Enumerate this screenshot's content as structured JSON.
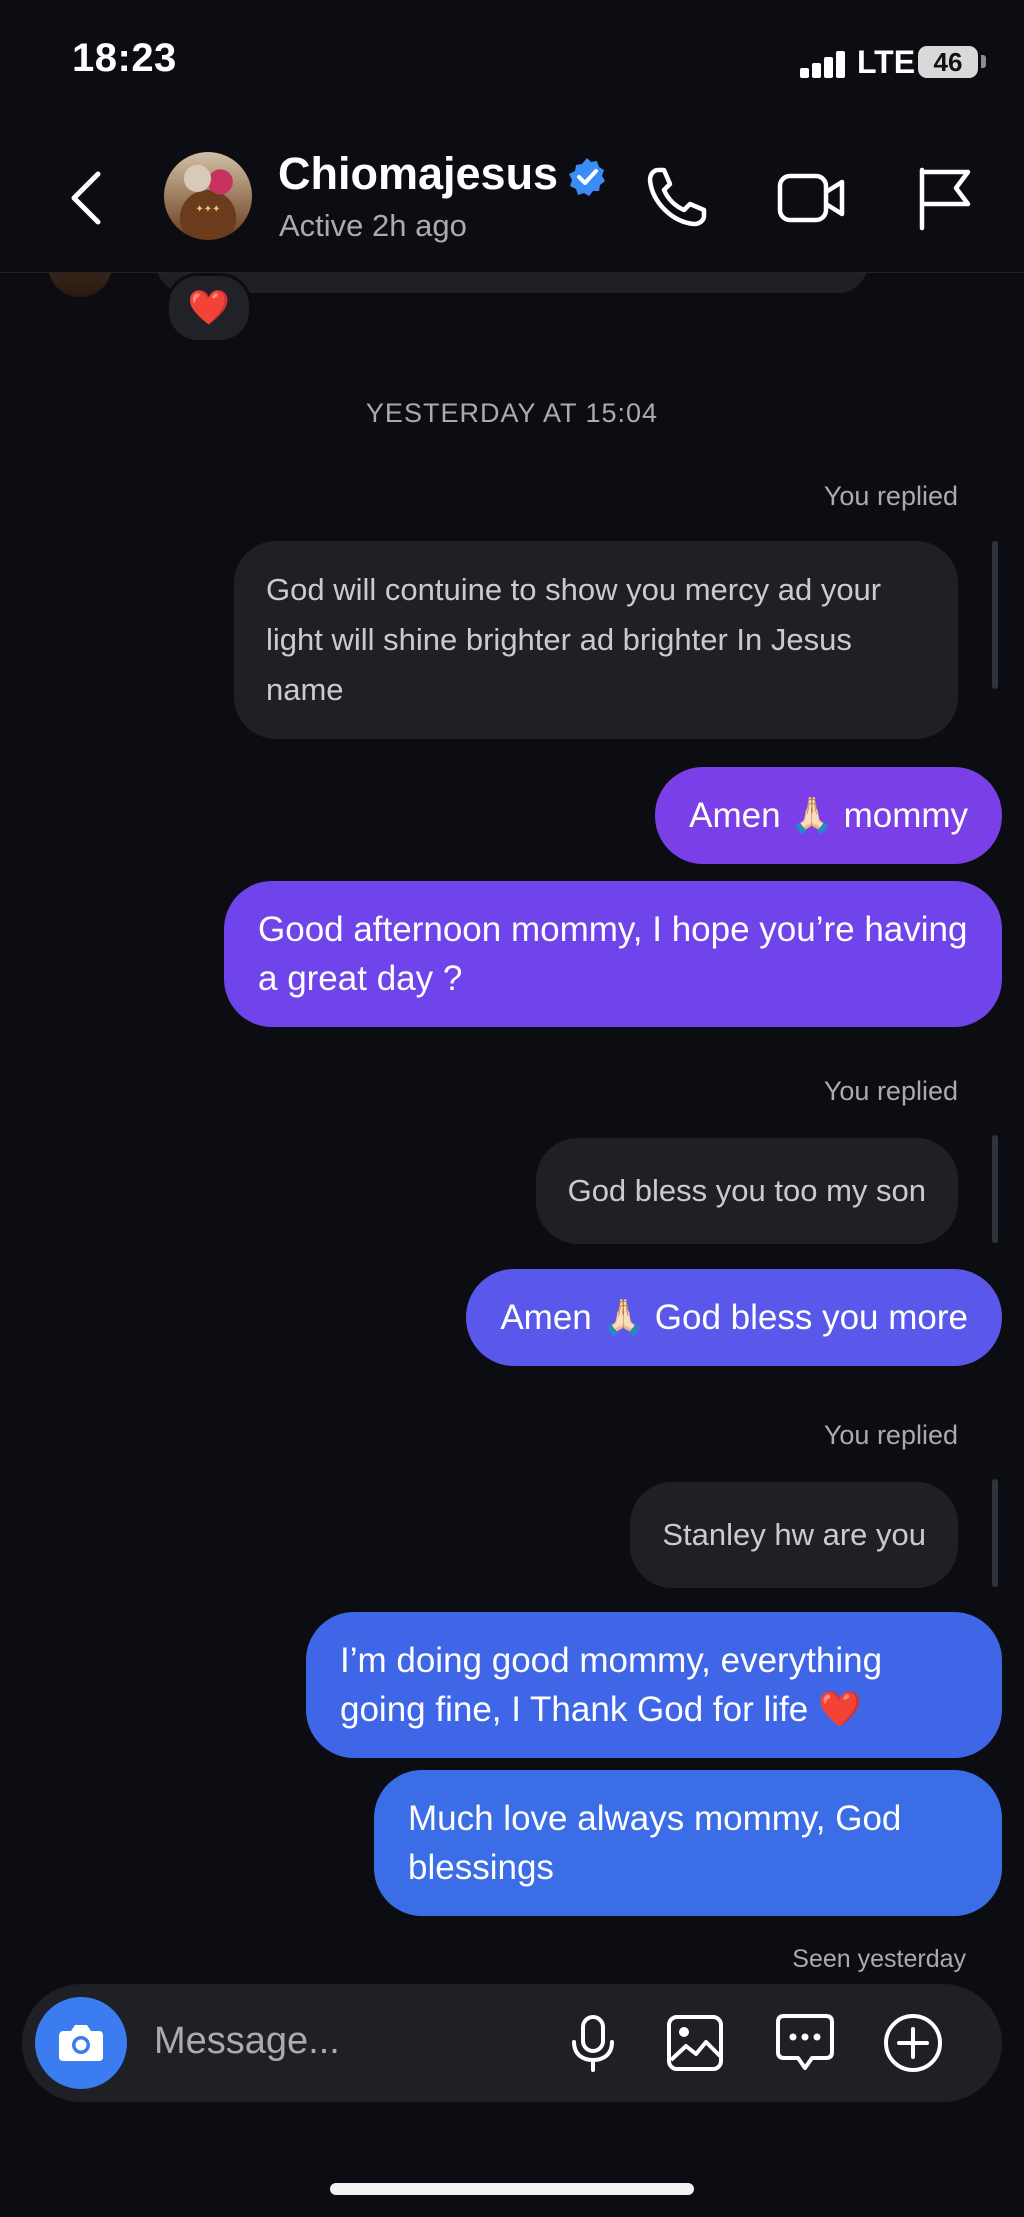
{
  "status_bar": {
    "time": "18:23",
    "network": "LTE",
    "battery": "46"
  },
  "header": {
    "contact_name": "Chiomajesus",
    "active_status": "Active 2h ago",
    "verified": true,
    "icons": [
      "back-icon",
      "phone-icon",
      "video-camera-icon",
      "flag-icon"
    ]
  },
  "chat": {
    "previous_reaction": "❤️",
    "timestamp": "YESTERDAY AT 15:04",
    "messages": [
      {
        "type": "reply-label",
        "text": "You replied"
      },
      {
        "type": "replied",
        "text": "God will contuine to show you mercy ad your light will shine brighter ad brighter In Jesus name"
      },
      {
        "type": "sent",
        "text": "Amen 🙏🏻 mommy"
      },
      {
        "type": "sent",
        "text": "Good afternoon mommy, I hope you’re having a great day ?"
      },
      {
        "type": "reply-label",
        "text": "You replied"
      },
      {
        "type": "replied",
        "text": "God bless you too my  son"
      },
      {
        "type": "sent",
        "text": "Amen 🙏🏻 God bless you more"
      },
      {
        "type": "reply-label",
        "text": "You replied"
      },
      {
        "type": "replied",
        "text": "Stanley hw are you"
      },
      {
        "type": "sent",
        "text": "I’m doing good mommy, everything going fine, I Thank God for life ❤️"
      },
      {
        "type": "sent",
        "text": "Much love always mommy, God blessings"
      }
    ],
    "seen": "Seen yesterday"
  },
  "composer": {
    "placeholder": "Message...",
    "icons": [
      "camera-icon",
      "microphone-icon",
      "gallery-icon",
      "sticker-icon",
      "add-icon"
    ]
  },
  "colors": {
    "background": "#0b0d12",
    "received_bubble": "#1e2025",
    "sent_gradient_top": "#7a3fe8",
    "sent_gradient_bottom": "#3a6fe6",
    "accent_blue": "#3b7cf0"
  }
}
